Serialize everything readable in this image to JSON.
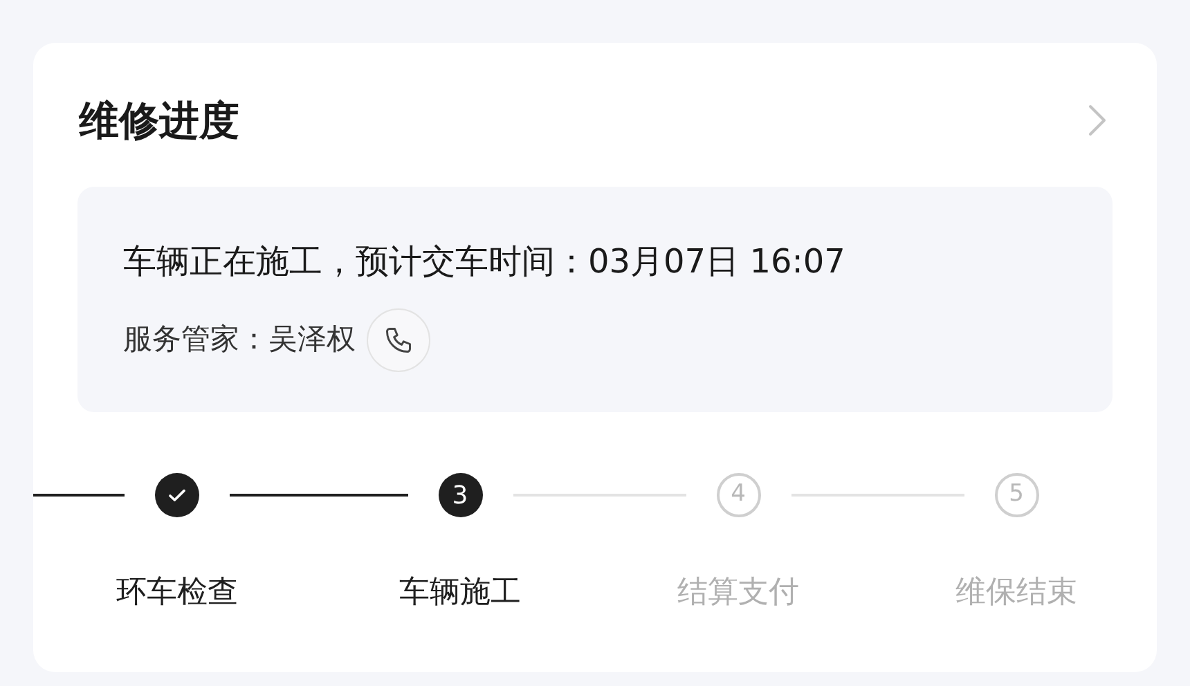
{
  "card": {
    "title": "维修进度"
  },
  "status": {
    "message": "车辆正在施工，预计交车时间：03月07日 16:07",
    "advisor_label": "服务管家：",
    "advisor_name": "吴泽权"
  },
  "steps": [
    {
      "label": "环车检查",
      "kind": "done"
    },
    {
      "label": "车辆施工",
      "kind": "current",
      "number": "3"
    },
    {
      "label": "结算支付",
      "kind": "pending",
      "number": "4"
    },
    {
      "label": "维保结束",
      "kind": "pending",
      "number": "5"
    }
  ]
}
